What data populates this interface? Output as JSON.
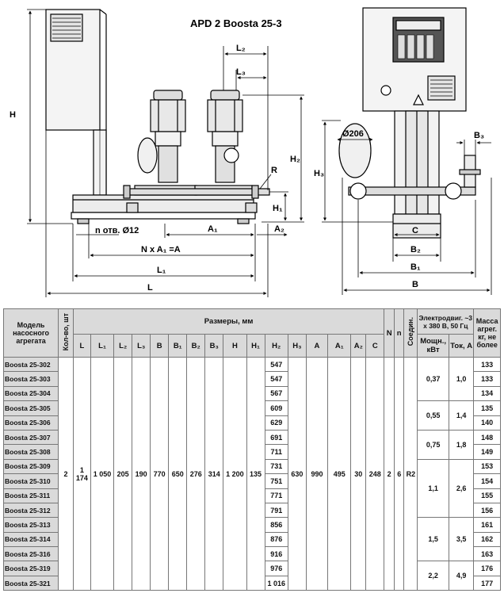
{
  "drawing": {
    "title": "APD 2 Boosta 25-3",
    "labels": {
      "H": "H",
      "H1": "H₁",
      "H2": "H₂",
      "H3": "H₃",
      "L": "L",
      "L1": "L₁",
      "L2": "L₂",
      "L3": "L₃",
      "A1": "A₁",
      "A2": "A₂",
      "R": "R",
      "holes": "n отв. Ø12",
      "NxA1": "N x A₁ =A",
      "diam": "Ø206",
      "B": "B",
      "B1": "B₁",
      "B2": "B₂",
      "B3": "B₃",
      "C": "C"
    }
  },
  "table": {
    "header": {
      "model": "Модель насосного агрегата",
      "qty": "Кол-во, шт",
      "dims": "Размеры, мм",
      "N": "N",
      "n": "n",
      "conn": "Соедин.",
      "motor": "Электродвиг. ~3 x 380 В, 50 Гц",
      "mass": "Масса агрег. кг, не более",
      "power": "Мощн., кВт",
      "current": "Ток, А",
      "dim_cols": [
        "L",
        "L₁",
        "L₂",
        "L₃",
        "B",
        "B₁",
        "B₂",
        "B₃",
        "H",
        "H₁",
        "H₂",
        "H₃",
        "A",
        "A₁",
        "A₂",
        "C"
      ]
    },
    "models": [
      "Boosta 25-302",
      "Boosta 25-303",
      "Boosta 25-304",
      "Boosta 25-305",
      "Boosta 25-306",
      "Boosta 25-307",
      "Boosta 25-308",
      "Boosta 25-309",
      "Boosta 25-310",
      "Boosta 25-311",
      "Boosta 25-312",
      "Boosta 25-313",
      "Boosta 25-314",
      "Boosta 25-316",
      "Boosta 25-319",
      "Boosta 25-321"
    ],
    "h2": [
      "547",
      "547",
      "567",
      "609",
      "629",
      "691",
      "711",
      "731",
      "751",
      "771",
      "791",
      "856",
      "876",
      "916",
      "976",
      "1 016"
    ],
    "mass": [
      "133",
      "133",
      "134",
      "135",
      "140",
      "148",
      "149",
      "153",
      "154",
      "155",
      "156",
      "161",
      "162",
      "163",
      "176",
      "177"
    ],
    "common": {
      "qty": "2",
      "L": "1 174",
      "L1": "1 050",
      "L2": "205",
      "L3": "190",
      "B": "770",
      "B1": "650",
      "B2": "276",
      "B3": "314",
      "H": "1 200",
      "H1": "135",
      "H3": "630",
      "A": "990",
      "A1": "495",
      "A2": "30",
      "C": "248",
      "N": "2",
      "n": "6",
      "conn": "R2"
    },
    "motor_groups": [
      {
        "power": "0,37",
        "current": "1,0",
        "rows": 3
      },
      {
        "power": "0,55",
        "current": "1,4",
        "rows": 2
      },
      {
        "power": "0,75",
        "current": "1,8",
        "rows": 2
      },
      {
        "power": "1,1",
        "current": "2,6",
        "rows": 4
      },
      {
        "power": "1,5",
        "current": "3,5",
        "rows": 3
      },
      {
        "power": "2,2",
        "current": "4,9",
        "rows": 2
      }
    ]
  }
}
